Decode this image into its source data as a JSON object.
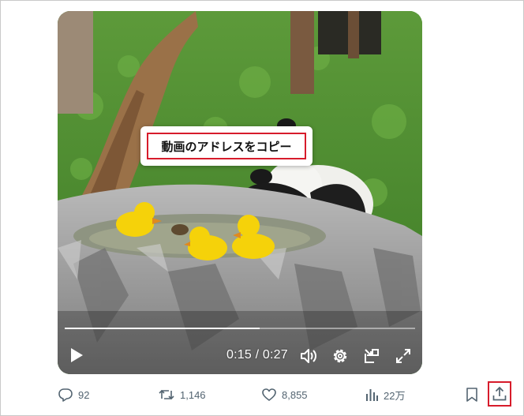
{
  "video": {
    "time_display": "0:15 / 0:27",
    "progress": 0.556,
    "icons": [
      "play-icon",
      "volume-icon",
      "settings-gear-icon",
      "picture-in-picture-icon",
      "fullscreen-icon"
    ]
  },
  "context_menu": {
    "copy_video_address": "動画のアドレスをコピー"
  },
  "actions": {
    "replies": "92",
    "reposts": "1,146",
    "likes": "8,855",
    "views": "22万",
    "icons": [
      "reply-icon",
      "repost-icon",
      "like-icon",
      "views-icon",
      "bookmark-icon",
      "share-icon"
    ]
  },
  "colors": {
    "highlight_border": "#d71c2b",
    "action_gray": "#536471"
  }
}
